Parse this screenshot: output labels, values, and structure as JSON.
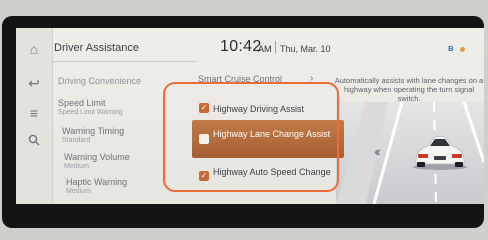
{
  "header": {
    "title": "Driver Assistance",
    "time": "10:42",
    "ampm": "AM",
    "date": "Thu, Mar. 10"
  },
  "rail": {
    "items": [
      {
        "icon": "home-icon"
      },
      {
        "icon": "back-icon"
      },
      {
        "icon": "menu-icon"
      },
      {
        "icon": "search-icon"
      }
    ]
  },
  "categories": [
    {
      "label": "Driving Convenience",
      "sub": ""
    },
    {
      "label": "Speed Limit",
      "sub": "Speed Limit Warning"
    },
    {
      "label": "Warning Timing",
      "sub": "Standard"
    },
    {
      "label": "Warning Volume",
      "sub": "Medium"
    },
    {
      "label": "Haptic Warning",
      "sub": "Medium"
    }
  ],
  "submenu": {
    "label": "Smart Cruise Control"
  },
  "options": [
    {
      "label": "Highway Driving Assist",
      "checked": true
    },
    {
      "label": "Highway Lane Change Assist",
      "checked": false
    },
    {
      "label": "Highway Auto Speed Change",
      "checked": true
    }
  ],
  "description": "Automatically assists with lane changes on a highway when operating the turn signal switch.",
  "colors": {
    "accent": "#c96a34",
    "highlight_ring": "#ee6a3a"
  }
}
